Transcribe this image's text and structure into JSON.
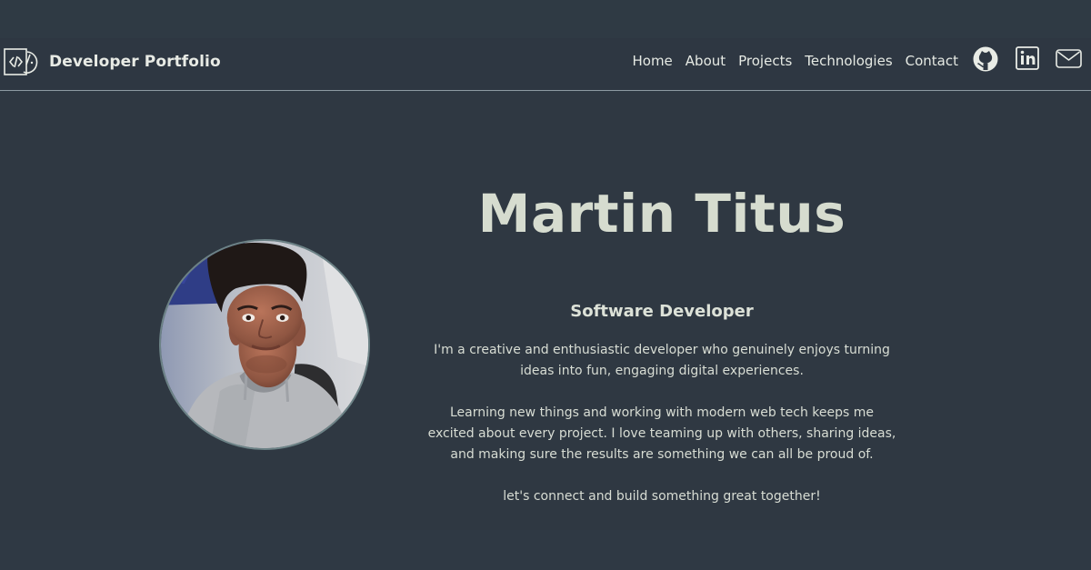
{
  "header": {
    "brand_name": "Developer Portfolio",
    "nav": [
      {
        "label": "Home"
      },
      {
        "label": "About"
      },
      {
        "label": "Projects"
      },
      {
        "label": "Technologies"
      },
      {
        "label": "Contact"
      }
    ],
    "social_icons": [
      "github-icon",
      "linkedin-icon",
      "mail-icon"
    ]
  },
  "hero": {
    "name": "Martin Titus",
    "role": "Software Developer",
    "bio": [
      "I'm a creative and enthusiastic developer who genuinely enjoys turning ideas into fun, engaging digital experiences.",
      "Learning new things and working with modern web tech keeps me excited about every project. I love teaming up with others, sharing ideas, and making sure the results are something we can all be proud of.",
      "let's connect and build something great together!"
    ]
  },
  "colors": {
    "background": "#2f3a44",
    "navbar": "#2e3742",
    "text": "#dfe4dc",
    "heading": "#d6dccf",
    "avatar_border": "#6c8286"
  }
}
